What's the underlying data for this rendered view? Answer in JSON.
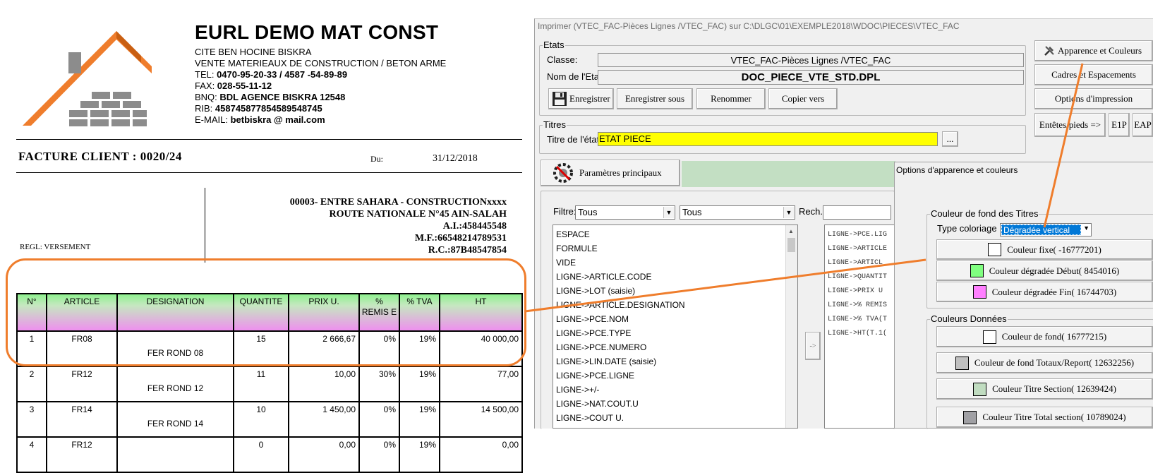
{
  "invoice": {
    "company_name": "EURL DEMO MAT CONST",
    "address_lines": [
      {
        "label": "CITE BEN HOCINE BISKRA",
        "value": ""
      },
      {
        "label": "VENTE MATERIEAUX DE CONSTRUCTION  / BETON ARME",
        "value": ""
      },
      {
        "label": "TEL: ",
        "value": "0470-95-20-33 / 4587 -54-89-89"
      },
      {
        "label": "FAX: ",
        "value": "028-55-11-12"
      },
      {
        "label": "BNQ: ",
        "value": "BDL AGENCE BISKRA 12548"
      },
      {
        "label": "RIB: ",
        "value": "458745877854589548745"
      },
      {
        "label": "E-MAIL: ",
        "value": "betbiskra @ mail.com"
      }
    ],
    "invoice_title": "FACTURE CLIENT : 0020/24",
    "du_label": "Du:",
    "date": "31/12/2018",
    "client_lines": [
      "00003- ENTRE SAHARA - CONSTRUCTIONxxxx",
      "ROUTE NATIONALE N°45 AIN-SALAH",
      "A.I.:458445548",
      "M.F.:66548214789531",
      "R.C.:87B48547854"
    ],
    "reglement": "REGL: VERSEMENT",
    "table": {
      "headers": [
        "N°",
        "ARTICLE",
        "DESIGNATION",
        "QUANTITE",
        "PRIX U.",
        "% REMIS E",
        "% TVA",
        "HT"
      ],
      "rows": [
        [
          "1",
          "FR08",
          "FER ROND 08",
          "15",
          "2 666,67",
          "0%",
          "19%",
          "40 000,00"
        ],
        [
          "2",
          "FR12",
          "FER ROND 12",
          "11",
          "10,00",
          "30%",
          "19%",
          "77,00"
        ],
        [
          "3",
          "FR14",
          "FER ROND 14",
          "10",
          "1 450,00",
          "0%",
          "19%",
          "14 500,00"
        ],
        [
          "4",
          "FR12",
          "",
          "0",
          "0,00",
          "0%",
          "19%",
          "0,00"
        ]
      ]
    }
  },
  "dialog": {
    "title": "Imprimer (VTEC_FAC-Pièces Lignes /VTEC_FAC)  sur C:\\DLGC\\01\\EXEMPLE2018\\WDOC\\PIECES\\VTEC_FAC",
    "etats_label": "Etats",
    "classe_label": "Classe:",
    "classe_value": "VTEC_FAC-Pièces Lignes /VTEC_FAC",
    "nom_label": "Nom de l'Etat:",
    "nom_value": "DOC_PIECE_VTE_STD.DPL",
    "buttons": {
      "enregistrer": "Enregistrer",
      "enregistrer_sous": "Enregistrer sous",
      "renommer": "Renommer",
      "copier_vers": "Copier vers",
      "apparence": "Apparence et Couleurs",
      "cadres": "Cadres et Espacements",
      "options_impression": "Options d'impression",
      "entetes": "Entêtes/pieds =>",
      "e1p": "E1P",
      "eap": "EAP",
      "parametres": "Paramètres principaux",
      "ellipsis": "...",
      "side_arrow": "->"
    },
    "titres_label": "Titres",
    "titre_etat_label": "Titre de l'état:",
    "titre_etat_value": "ETAT PIECE",
    "filtre_label": "Filtre:",
    "filtre_value_1": "Tous",
    "filtre_value_2": "Tous",
    "rech_label": "Rech.:",
    "rech_value": "",
    "fields_list": [
      "ESPACE",
      "FORMULE",
      "VIDE",
      "LIGNE->ARTICLE.CODE",
      "LIGNE->LOT (saisie)",
      "LIGNE->ARTICLE.DESIGNATION",
      "LIGNE->PCE.NOM",
      "LIGNE->PCE.TYPE",
      "LIGNE->PCE.NUMERO",
      "LIGNE->LIN.DATE (saisie)",
      "LIGNE->PCE.LIGNE",
      "LIGNE->+/-",
      "LIGNE->NAT.COUT.U",
      "LIGNE->COUT U."
    ],
    "selected_list": [
      "LIGNE->PCE.LIG",
      "LIGNE->ARTICLE",
      "LIGNE->ARTICL",
      "LIGNE->QUANTIT",
      "LIGNE->PRIX U",
      "LIGNE->% REMIS",
      "LIGNE->% TVA(T",
      "LIGNE->HT(T.1("
    ]
  },
  "options_panel": {
    "title": "Options d'apparence et couleurs",
    "fond_titres_label": "Couleur de fond des Titres",
    "type_coloriage_label": "Type coloriage :",
    "type_coloriage_value": "Dégradée vertical",
    "title_colors": [
      {
        "label": "Couleur fixe( -16777201)",
        "color": "#ffffff"
      },
      {
        "label": "Couleur dégradée Début( 8454016)",
        "color": "#80ff80"
      },
      {
        "label": "Couleur dégradée Fin( 16744703)",
        "color": "#ff80ff"
      }
    ],
    "donnees_label": "Couleurs Données",
    "data_colors": [
      {
        "label": "Couleur de fond( 16777215)",
        "color": "#ffffff"
      },
      {
        "label": "Couleur de fond Totaux/Report( 12632256)",
        "color": "#c0c0c0"
      },
      {
        "label": "Couleur Titre Section( 12639424)",
        "color": "#c0dcc0"
      },
      {
        "label": "Couleur Titre Total section( 10789024)",
        "color": "#a0a0a4"
      }
    ]
  },
  "colors": {
    "accent_orange": "#ef7d2c",
    "header_gradient_start": "#80ff80",
    "header_gradient_end": "#ff80ff",
    "title_field_yellow": "#ffff00"
  }
}
